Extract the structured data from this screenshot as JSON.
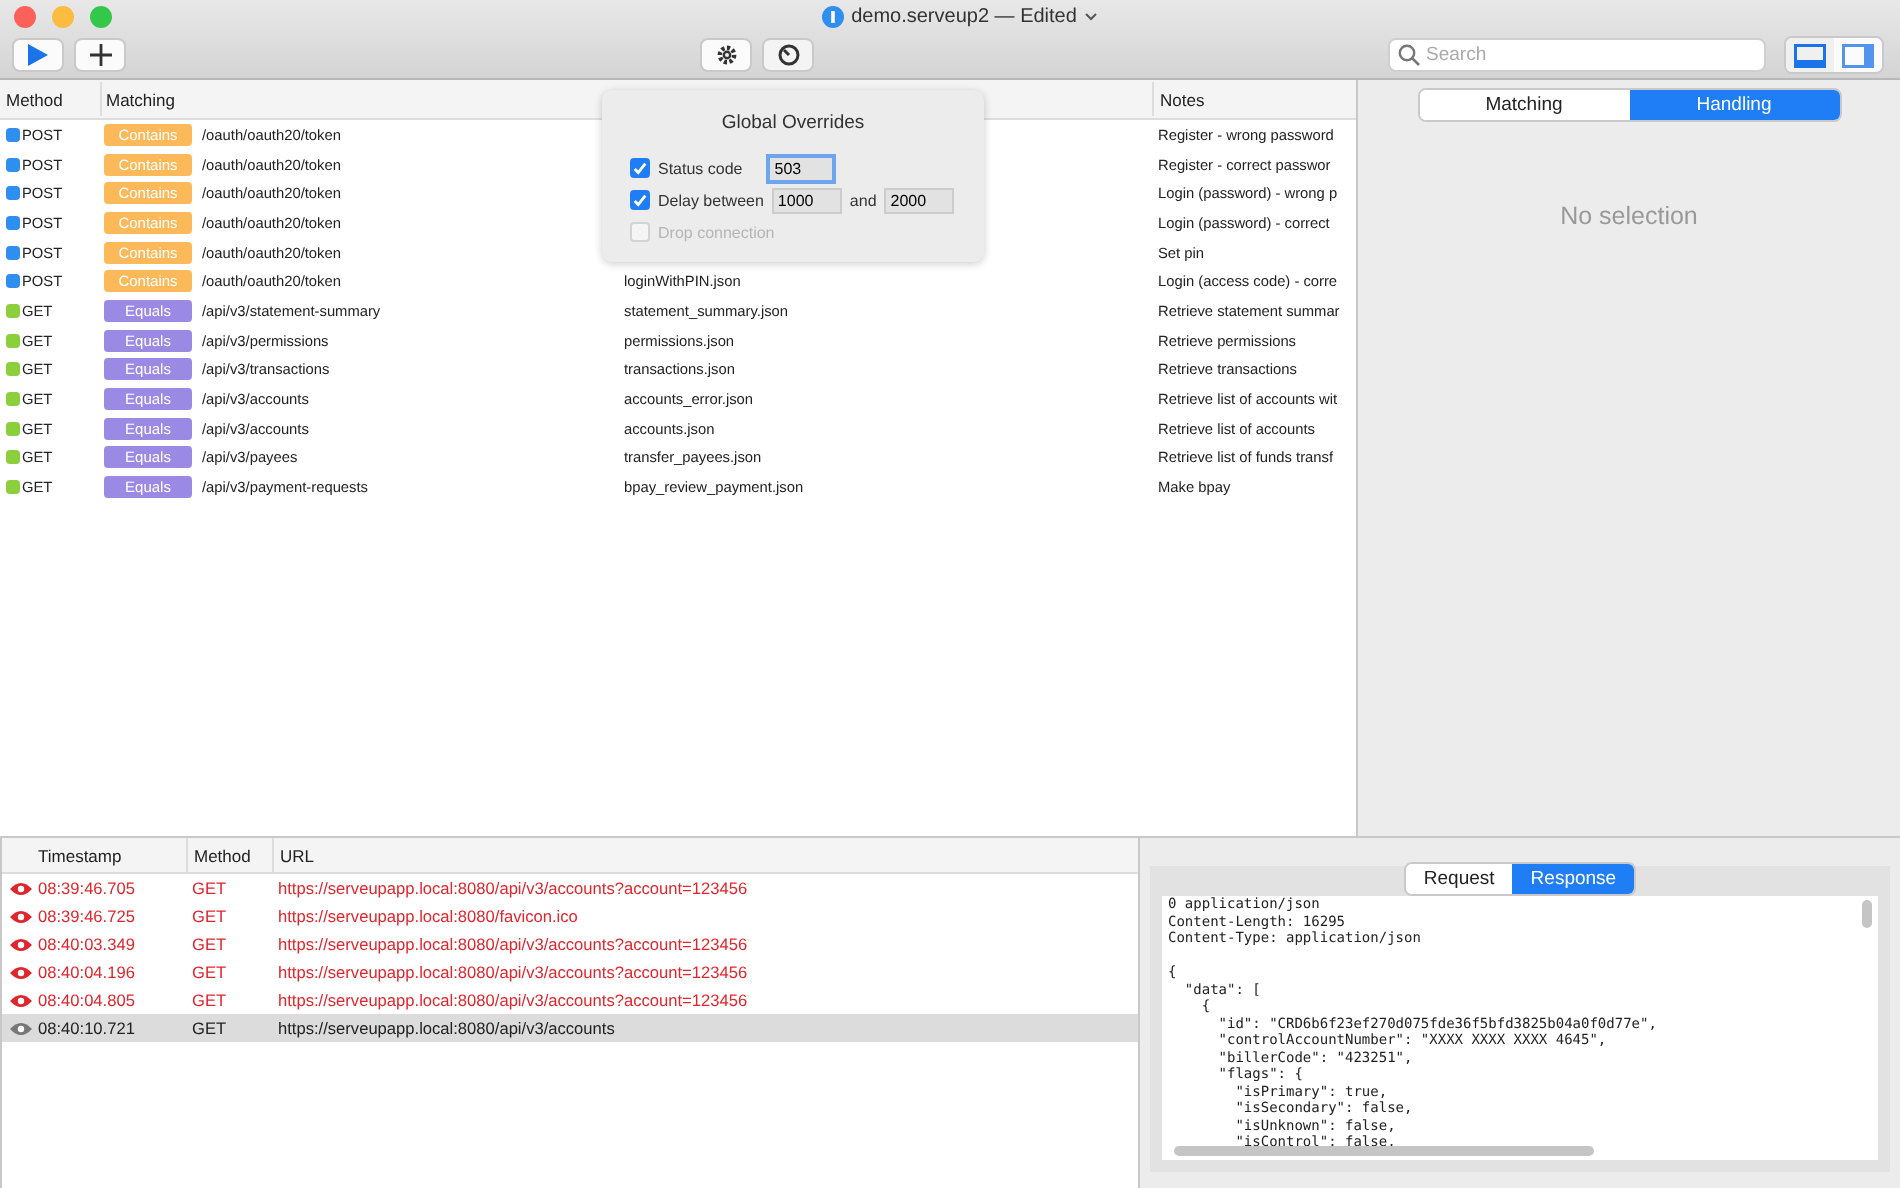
{
  "window": {
    "title": "demo.serveup2 — Edited"
  },
  "search": {
    "placeholder": "Search"
  },
  "layout_buttons": [
    {
      "kind": "bottom",
      "selected": true
    },
    {
      "kind": "side",
      "selected": false
    }
  ],
  "rules": {
    "columns": [
      "Method",
      "Matching",
      "Notes"
    ],
    "rows": [
      {
        "method": "POST",
        "color": "#2f8ff0",
        "match": "Contains",
        "path": "/oauth/oauth20/token",
        "notes": "Register - wrong password"
      },
      {
        "method": "POST",
        "color": "#2f8ff0",
        "match": "Contains",
        "path": "/oauth/oauth20/token",
        "notes": "Register - correct passwor"
      },
      {
        "method": "POST",
        "color": "#2f8ff0",
        "match": "Contains",
        "path": "/oauth/oauth20/token",
        "notes": "Login (password) - wrong p"
      },
      {
        "method": "POST",
        "color": "#2f8ff0",
        "match": "Contains",
        "path": "/oauth/oauth20/token",
        "notes": "Login (password) - correct"
      },
      {
        "method": "POST",
        "color": "#2f8ff0",
        "match": "Contains",
        "path": "/oauth/oauth20/token",
        "notes": "Set pin"
      },
      {
        "method": "POST",
        "color": "#2f8ff0",
        "match": "Contains",
        "path": "/oauth/oauth20/token",
        "file": "loginWithPIN.json",
        "notes": "Login (access code) - corre"
      },
      {
        "method": "GET",
        "color": "#8ccf3c",
        "match": "Equals",
        "path": "/api/v3/statement-summary",
        "file": "statement_summary.json",
        "notes": "Retrieve statement summar"
      },
      {
        "method": "GET",
        "color": "#8ccf3c",
        "match": "Equals",
        "path": "/api/v3/permissions",
        "file": "permissions.json",
        "notes": "Retrieve permissions"
      },
      {
        "method": "GET",
        "color": "#8ccf3c",
        "match": "Equals",
        "path": "/api/v3/transactions",
        "file": "transactions.json",
        "notes": "Retrieve transactions"
      },
      {
        "method": "GET",
        "color": "#8ccf3c",
        "match": "Equals",
        "path": "/api/v3/accounts",
        "file": "accounts_error.json",
        "notes": "Retrieve list of accounts wit"
      },
      {
        "method": "GET",
        "color": "#8ccf3c",
        "match": "Equals",
        "path": "/api/v3/accounts",
        "file": "accounts.json",
        "notes": "Retrieve list of accounts"
      },
      {
        "method": "GET",
        "color": "#8ccf3c",
        "match": "Equals",
        "path": "/api/v3/payees",
        "file": "transfer_payees.json",
        "notes": "Retrieve list of funds transf"
      },
      {
        "method": "GET",
        "color": "#8ccf3c",
        "match": "Equals",
        "path": "/api/v3/payment-requests",
        "file": "bpay_review_payment.json",
        "notes": "Make bpay"
      }
    ]
  },
  "overrides": {
    "title": "Global Overrides",
    "status": {
      "label": "Status code",
      "checked": true,
      "value": "503"
    },
    "delay": {
      "label": "Delay between",
      "checked": true,
      "from": "1000",
      "joiner": "and",
      "to": "2000"
    },
    "drop": {
      "label": "Drop connection",
      "checked": false,
      "disabled": true
    }
  },
  "detail_tabs": [
    {
      "label": "Matching",
      "selected": false
    },
    {
      "label": "Handling",
      "selected": true
    }
  ],
  "empty": "No selection",
  "log": {
    "columns": [
      "Timestamp",
      "Method",
      "URL"
    ],
    "rows": [
      {
        "time": "08:39:46.705",
        "method": "GET",
        "url": "https://serveupapp.local:8080/api/v3/accounts?account=123456",
        "overridden": true,
        "selected": false
      },
      {
        "time": "08:39:46.725",
        "method": "GET",
        "url": "https://serveupapp.local:8080/favicon.ico",
        "overridden": true,
        "selected": false
      },
      {
        "time": "08:40:03.349",
        "method": "GET",
        "url": "https://serveupapp.local:8080/api/v3/accounts?account=123456",
        "overridden": true,
        "selected": false
      },
      {
        "time": "08:40:04.196",
        "method": "GET",
        "url": "https://serveupapp.local:8080/api/v3/accounts?account=123456",
        "overridden": true,
        "selected": false
      },
      {
        "time": "08:40:04.805",
        "method": "GET",
        "url": "https://serveupapp.local:8080/api/v3/accounts?account=123456",
        "overridden": true,
        "selected": false
      },
      {
        "time": "08:40:10.721",
        "method": "GET",
        "url": "https://serveupapp.local:8080/api/v3/accounts",
        "overridden": false,
        "selected": true
      }
    ]
  },
  "message_tabs": [
    {
      "label": "Request",
      "selected": false
    },
    {
      "label": "Response",
      "selected": true
    }
  ],
  "message_headers": [
    "0 application/json",
    "Content-Length: 16295",
    "Content-Type: application/json"
  ],
  "message_body": [
    "{",
    "  \"data\": [",
    "    {",
    "      \"id\": \"CRD6b6f23ef270d075fde36f5bfd3825b04a0f0d77e\",",
    "      \"controlAccountNumber\": \"XXXX XXXX XXXX 4645\",",
    "      \"billerCode\": \"423251\",",
    "      \"flags\": {",
    "        \"isPrimary\": true,",
    "        \"isSecondary\": false,",
    "        \"isUnknown\": false,",
    "        \"isControl\": false,"
  ]
}
